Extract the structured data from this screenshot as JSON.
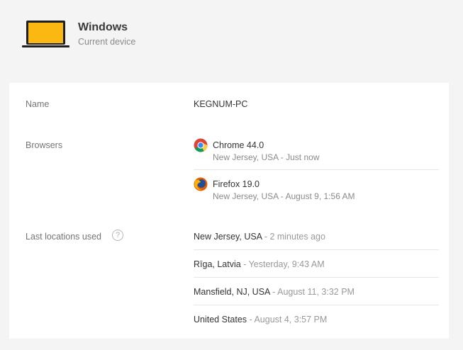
{
  "device": {
    "title": "Windows",
    "subtitle": "Current device",
    "icon": "laptop-icon",
    "icon_color": "#fbb812"
  },
  "details": {
    "name_label": "Name",
    "name_value": "KEGNUM-PC",
    "browsers_label": "Browsers",
    "browsers": [
      {
        "name": "Chrome 44.0",
        "meta": "New Jersey, USA - Just now",
        "icon": "chrome-icon"
      },
      {
        "name": "Firefox 19.0",
        "meta": "New Jersey, USA - August 9, 1:56 AM",
        "icon": "firefox-icon"
      }
    ],
    "locations_label": "Last locations used",
    "help_glyph": "?",
    "separator": " - ",
    "locations": [
      {
        "place": "New Jersey, USA",
        "when": "2 minutes ago"
      },
      {
        "place": "Rīga, Latvia",
        "when": "Yesterday, 9:43 AM"
      },
      {
        "place": "Mansfield, NJ, USA",
        "when": "August 11, 3:32 PM"
      },
      {
        "place": "United States",
        "when": "August 4, 3:57 PM"
      }
    ]
  }
}
